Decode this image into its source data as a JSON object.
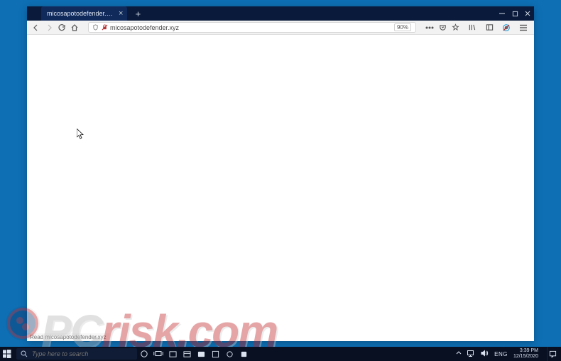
{
  "browser": {
    "tab_title": "micosapotodefender.xyz/",
    "url": "micosapotodefender.xyz",
    "zoom": "90%",
    "status_text": "Read micosapotodefender.xyz"
  },
  "taskbar": {
    "search_placeholder": "Type here to search",
    "language": "ENG",
    "time": "3:39 PM",
    "date": "12/15/2020"
  },
  "watermark": {
    "prefix": "PC",
    "suffix": "risk.com"
  }
}
